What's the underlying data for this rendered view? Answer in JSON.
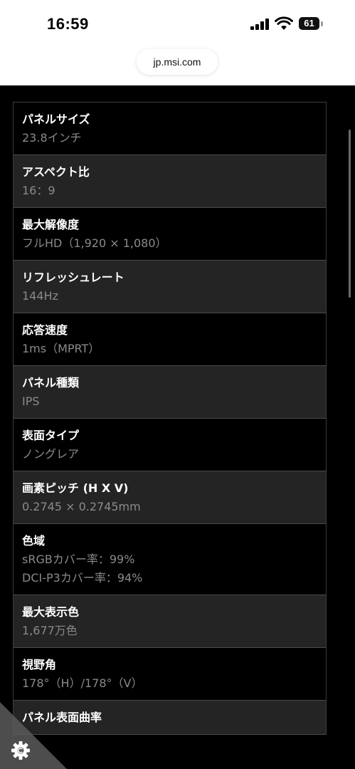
{
  "status_bar": {
    "time": "16:59",
    "battery": "61",
    "icons": [
      "signal-icon",
      "wifi-icon",
      "battery-icon"
    ]
  },
  "browser": {
    "url": "jp.msi.com"
  },
  "specs": [
    {
      "label": "パネルサイズ",
      "values": [
        "23.8インチ"
      ]
    },
    {
      "label": "アスペクト比",
      "values": [
        "16：9"
      ]
    },
    {
      "label": "最大解像度",
      "values": [
        "フルHD（1,920 × 1,080）"
      ]
    },
    {
      "label": "リフレッシュレート",
      "values": [
        "144Hz"
      ]
    },
    {
      "label": "応答速度",
      "values": [
        "1ms（MPRT）"
      ]
    },
    {
      "label": "パネル種類",
      "values": [
        "IPS"
      ]
    },
    {
      "label": "表面タイプ",
      "values": [
        "ノングレア"
      ]
    },
    {
      "label": "画素ピッチ (H X V)",
      "values": [
        "0.2745 × 0.2745mm"
      ]
    },
    {
      "label": "色域",
      "values": [
        "sRGBカバー率：99%",
        "DCI-P3カバー率：94%"
      ]
    },
    {
      "label": "最大表示色",
      "values": [
        "1,677万色"
      ]
    },
    {
      "label": "視野角",
      "values": [
        "178°（H）/178°（V）"
      ]
    },
    {
      "label": "パネル表面曲率",
      "values": []
    }
  ],
  "corner_badge": {
    "icon": "gear-icon"
  }
}
